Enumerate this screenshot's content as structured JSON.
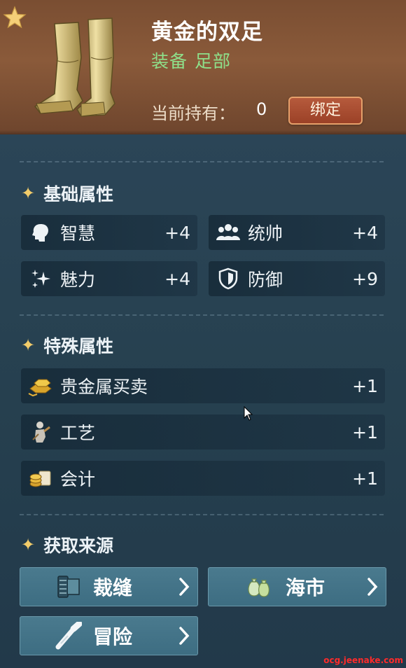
{
  "item": {
    "title": "黄金的双足",
    "type_main": "装备",
    "type_slot": "足部",
    "hold_label": "当前持有：",
    "hold_count": "0",
    "bind_label": "绑定"
  },
  "basic": {
    "title": "基础属性",
    "stats": [
      {
        "label": "智慧",
        "value": "+4",
        "icon": "head-icon"
      },
      {
        "label": "统帅",
        "value": "+4",
        "icon": "people-icon"
      },
      {
        "label": "魅力",
        "value": "+4",
        "icon": "sparkle-icon"
      },
      {
        "label": "防御",
        "value": "+9",
        "icon": "shield-icon"
      }
    ]
  },
  "special": {
    "title": "特殊属性",
    "stats": [
      {
        "label": "贵金属买卖",
        "value": "+1",
        "icon": "gold-bars-icon"
      },
      {
        "label": "工艺",
        "value": "+1",
        "icon": "statue-icon"
      },
      {
        "label": "会计",
        "value": "+1",
        "icon": "coins-scroll-icon"
      }
    ]
  },
  "sources": {
    "title": "获取来源",
    "items": [
      {
        "label": "裁缝",
        "icon": "fabric-roll-icon"
      },
      {
        "label": "海市",
        "icon": "money-bag-icon"
      },
      {
        "label": "冒险",
        "icon": "telescope-icon"
      }
    ]
  },
  "watermark": "ocg.jeenake.com",
  "colors": {
    "header_bg": "#8a5a3a",
    "panel_bg": "#26404f",
    "type_green": "#8ee08a",
    "accent_gold": "#f2cc6a",
    "bind_red": "#a84a2f",
    "button_teal": "#437389"
  }
}
